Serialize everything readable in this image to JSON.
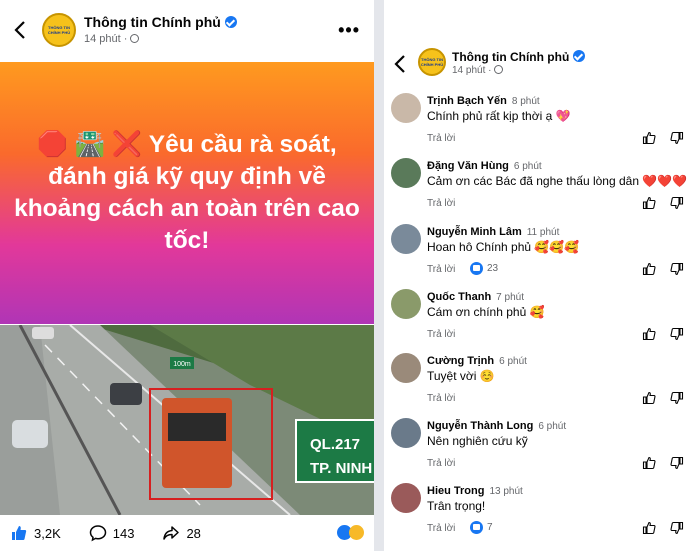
{
  "left": {
    "page_name": "Thông tin Chính phủ",
    "time": "14 phút",
    "logo_text": [
      "THÔNG TIN",
      "CHÍNH PHỦ"
    ],
    "banner_text": "🛑 🛣️ ❌ Yêu cầu rà soát, đánh giá kỹ quy định về khoảng cách an toàn trên cao tốc!",
    "road_sign": {
      "line1": "QL.217",
      "line2": "TP. NINH"
    },
    "km_sign": "100m",
    "reactions": {
      "likes": "3,2K",
      "comments": "143",
      "shares": "28"
    }
  },
  "right": {
    "page_name": "Thông tin Chính phủ",
    "time": "14 phút",
    "reply_label": "Trả lời",
    "comments": [
      {
        "name": "Trịnh Bạch Yến",
        "time": "8 phút",
        "text": "Chính phủ rất kịp thời ạ 💖",
        "likes": ""
      },
      {
        "name": "Đặng Văn Hùng",
        "time": "6 phút",
        "text": "Cảm ơn các Bác đã nghe thấu lòng dân ❤️❤️❤️",
        "likes": ""
      },
      {
        "name": "Nguyễn Minh Lâm",
        "time": "11 phút",
        "text": "Hoan hô Chính phủ 🥰🥰🥰",
        "likes": "23"
      },
      {
        "name": "Quốc Thanh",
        "time": "7 phút",
        "text": "Cám ơn chính phủ 🥰",
        "likes": ""
      },
      {
        "name": "Cường Trịnh",
        "time": "6 phút",
        "text": "Tuyệt vời ☺️",
        "likes": ""
      },
      {
        "name": "Nguyễn Thành Long",
        "time": "6 phút",
        "text": "Nên nghiên cứu kỹ",
        "likes": ""
      },
      {
        "name": "Hieu Trong",
        "time": "13 phút",
        "text": "Trân trọng!",
        "likes": "7"
      }
    ]
  },
  "colors": {
    "accent": "#1877f2",
    "muted": "#65676b",
    "sign_green": "#1c7a45"
  }
}
